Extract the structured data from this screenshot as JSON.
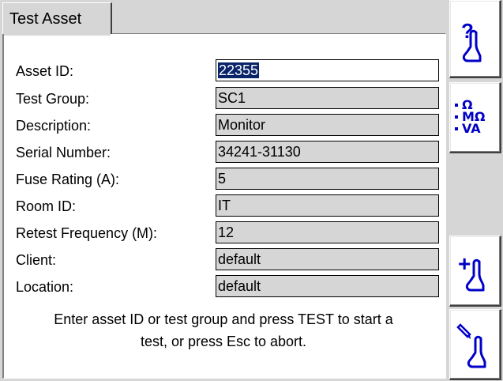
{
  "tab": {
    "title": "Test Asset"
  },
  "form": {
    "fields": [
      {
        "label": "Asset ID:",
        "value": "22355"
      },
      {
        "label": "Test Group:",
        "value": "SC1"
      },
      {
        "label": "Description:",
        "value": "Monitor"
      },
      {
        "label": "Serial Number:",
        "value": "34241-31130"
      },
      {
        "label": "Fuse Rating (A):",
        "value": "5"
      },
      {
        "label": "Room ID:",
        "value": "IT"
      },
      {
        "label": "Retest Frequency (M):",
        "value": "12"
      },
      {
        "label": "Client:",
        "value": "default"
      },
      {
        "label": "Location:",
        "value": "default"
      }
    ]
  },
  "instructions": {
    "line1": "Enter asset ID or test group and press TEST to start a",
    "line2": "test, or press Esc to abort."
  },
  "toolbar": {
    "help_glyph": "?",
    "units": [
      "Ω",
      "MΩ",
      "VA"
    ],
    "add_glyph": "+",
    "icons": [
      "help-icon",
      "units-icon",
      "add-icon",
      "edit-icon"
    ]
  },
  "colors": {
    "background": "#d6d6d6",
    "panel": "#ffffff",
    "icon_blue": "#0000c8",
    "selection": "#0a246a"
  }
}
